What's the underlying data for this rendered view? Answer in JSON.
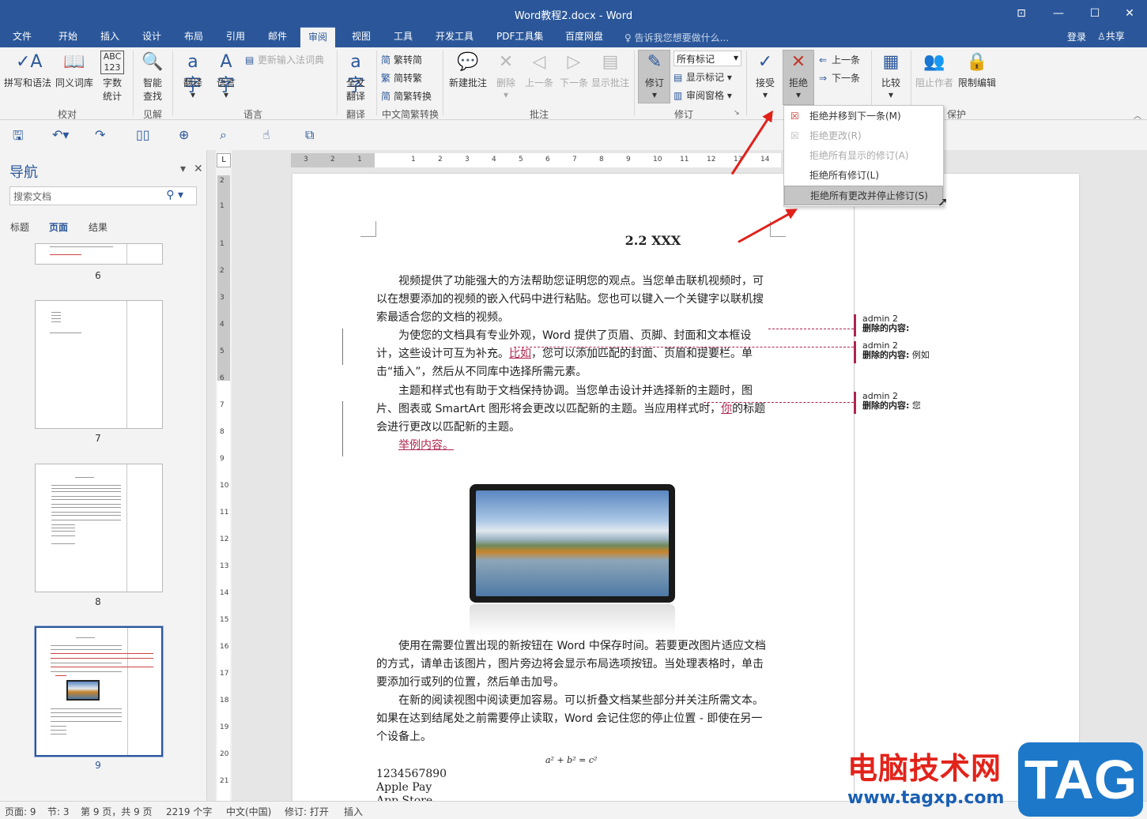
{
  "window": {
    "title": "Word教程2.docx - Word"
  },
  "menu": {
    "tabs": [
      "文件",
      "开始",
      "插入",
      "设计",
      "布局",
      "引用",
      "邮件",
      "审阅",
      "视图",
      "工具",
      "开发工具",
      "PDF工具集",
      "百度网盘"
    ],
    "active_tab": "审阅",
    "tell_me": "告诉我您想要做什么...",
    "login": "登录",
    "share": "共享"
  },
  "ribbon": {
    "proofing": {
      "spell": "拼写和语法",
      "thesaurus": "同义词库",
      "wordcount_icon": "ABC 123",
      "wordcount": "字数统计",
      "group": "校对"
    },
    "insights": {
      "smart_lookup": "智能查找",
      "group": "见解"
    },
    "language": {
      "translate": "翻译",
      "language": "语言",
      "update_ime": "更新输入法词典",
      "group": "语言"
    },
    "translation": {
      "full_translate": "全文翻译",
      "group": "翻译"
    },
    "chinese_conversion": {
      "to_simplified": "繁转简",
      "to_traditional": "简转繁",
      "convert": "简繁转换",
      "group": "中文简繁转换"
    },
    "comments": {
      "new": "新建批注",
      "delete": "删除",
      "prev": "上一条",
      "next": "下一条",
      "show": "显示批注",
      "group": "批注"
    },
    "tracking": {
      "track": "修订",
      "markup_combo": "所有标记",
      "show_markup": "显示标记",
      "review_pane": "审阅窗格",
      "group": "修订"
    },
    "changes": {
      "accept": "接受",
      "reject": "拒绝",
      "prev": "上一条",
      "next": "下一条"
    },
    "compare": {
      "compare": "比较"
    },
    "protect": {
      "block_authors": "阻止作者",
      "restrict": "限制编辑",
      "group": "保护"
    }
  },
  "reject_menu": {
    "items": [
      {
        "label": "拒绝并移到下一条(M)",
        "enabled": true
      },
      {
        "label": "拒绝更改(R)",
        "enabled": false
      },
      {
        "label": "拒绝所有显示的修订(A)",
        "enabled": false
      },
      {
        "label": "拒绝所有修订(L)",
        "enabled": true
      },
      {
        "label": "拒绝所有更改并停止修订(S)",
        "enabled": true,
        "highlighted": true
      }
    ]
  },
  "nav": {
    "title": "导航",
    "search_placeholder": "搜索文档",
    "tabs": [
      "标题",
      "页面",
      "结果"
    ],
    "active_tab": "页面",
    "pages": [
      "6",
      "7",
      "8",
      "9"
    ],
    "selected_page": "9"
  },
  "ruler": {
    "corner": "L",
    "h_left": [
      "3",
      "2",
      "1"
    ],
    "h_right": [
      "1",
      "2",
      "3",
      "4",
      "5",
      "6",
      "7",
      "8",
      "9",
      "10",
      "11",
      "12",
      "13",
      "14",
      "15"
    ],
    "v_top": [
      "2",
      "1"
    ],
    "v_main": [
      "1",
      "2",
      "3",
      "4",
      "5",
      "6",
      "7",
      "8",
      "9",
      "10",
      "11",
      "12",
      "13",
      "14",
      "15",
      "16",
      "17",
      "18",
      "19",
      "20",
      "21"
    ]
  },
  "document": {
    "heading": "2.2 XXX",
    "p1": "视频提供了功能强大的方法帮助您证明您的观点。当您单击联机视频时，可以在想要添加的视频的嵌入代码中进行粘贴。您也可以键入一个关键字以联机搜索最适合您的文档的视频。",
    "p2_a": "为使您的文档具有专业外观，Word 提供了页眉、页脚、封面和文本框设计，这些设计可互为补充。",
    "p2_ins": "比如",
    "p2_b": "，您可以添加匹配的封面、页眉和提要栏。单击“插入”，然后从不同库中选择所需元素。",
    "p3_a": "主题和样式也有助于文档保持协调。当您单击设计并选择新的主题时，图片、图表或 SmartArt 图形将会更改以匹配新的主题。当应用样式时，",
    "p3_ins": "你",
    "p3_b": "的标题会进行更改以匹配新的主题。",
    "p4_ins": "举例内容。",
    "p5": "使用在需要位置出现的新按钮在 Word 中保存时间。若要更改图片适应文档的方式，请单击该图片，图片旁边将会显示布局选项按钮。当处理表格时，单击要添加行或列的位置，然后单击加号。",
    "p6": "在新的阅读视图中阅读更加容易。可以折叠文档某些部分并关注所需文本。如果在达到结尾处之前需要停止读取，Word 会记住您的停止位置 - 即使在另一个设备上。",
    "formula": "a² + b² = c²",
    "line1": "1234567890",
    "line2": "Apple Pay",
    "line3": "App Store"
  },
  "comments": [
    {
      "author": "admin 2",
      "label": "删除的内容:",
      "content": ""
    },
    {
      "author": "admin 2",
      "label": "删除的内容:",
      "content": "例如"
    },
    {
      "author": "admin 2",
      "label": "删除的内容:",
      "content": "您"
    }
  ],
  "status": {
    "page": "页面: 9",
    "section": "节: 3",
    "page_of": "第 9 页，共 9 页",
    "words": "2219 个字",
    "lang": "中文(中国)",
    "track": "修订: 打开",
    "mode": "插入"
  },
  "watermark": {
    "text": "电脑技术网",
    "url": "www.tagxp.com",
    "tag": "TAG"
  },
  "colors": {
    "accent": "#2b579a",
    "revision": "#b0254f",
    "arrow": "#e0211b"
  }
}
